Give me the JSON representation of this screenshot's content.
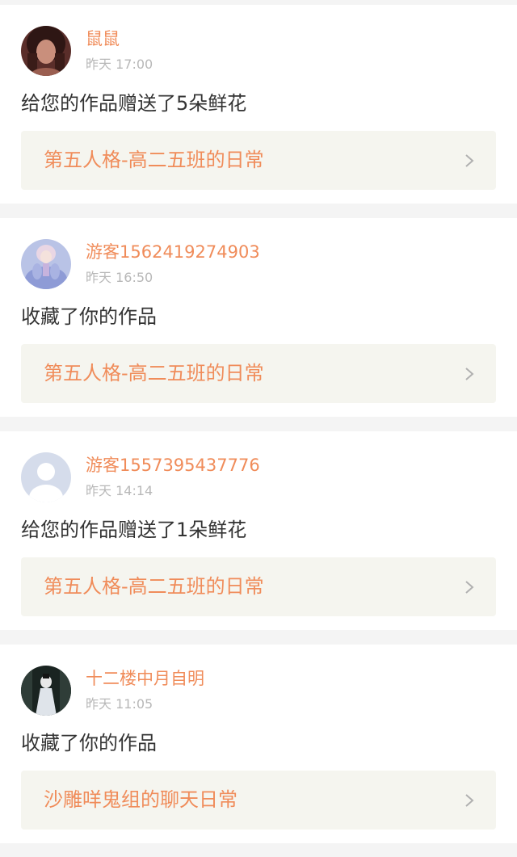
{
  "colors": {
    "accent": "#f08c5a",
    "time_text": "#b8b8b8",
    "body_text": "#333333",
    "link_bg": "#f5f5ef",
    "page_bg": "#f4f4f4"
  },
  "notifications": [
    {
      "username": "鼠鼠",
      "time": "昨天 17:00",
      "action": "给您的作品赠送了5朵鲜花",
      "work_title": "第五人格-高二五班的日常",
      "avatar_icon": "user-photo-avatar"
    },
    {
      "username": "游客1562419274903",
      "time": "昨天 16:50",
      "action": "收藏了你的作品",
      "work_title": "第五人格-高二五班的日常",
      "avatar_icon": "user-photo-avatar"
    },
    {
      "username": "游客1557395437776",
      "time": "昨天 14:14",
      "action": "给您的作品赠送了1朵鲜花",
      "work_title": "第五人格-高二五班的日常",
      "avatar_icon": "default-user-avatar"
    },
    {
      "username": "十二楼中月自明",
      "time": "昨天 11:05",
      "action": "收藏了你的作品",
      "work_title": "沙雕咩鬼组的聊天日常",
      "avatar_icon": "user-photo-avatar"
    }
  ]
}
